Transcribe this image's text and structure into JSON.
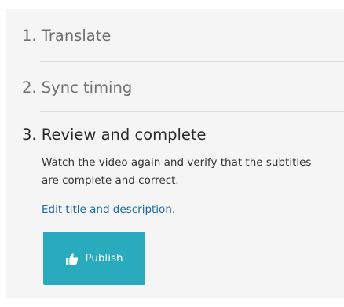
{
  "steps": [
    {
      "label": "1. Translate"
    },
    {
      "label": "2. Sync timing"
    },
    {
      "label": "3. Review and complete"
    }
  ],
  "active_step": {
    "description": "Watch the video again and verify that the subtitles are complete and correct.",
    "edit_link": "Edit title and description."
  },
  "publish_button": {
    "label": "Publish",
    "icon": "thumbs-up-icon",
    "color": "#2aaabd"
  },
  "colors": {
    "panel_background": "#f5f5f5",
    "inactive_text": "#707070",
    "link": "#1a6aa6"
  }
}
